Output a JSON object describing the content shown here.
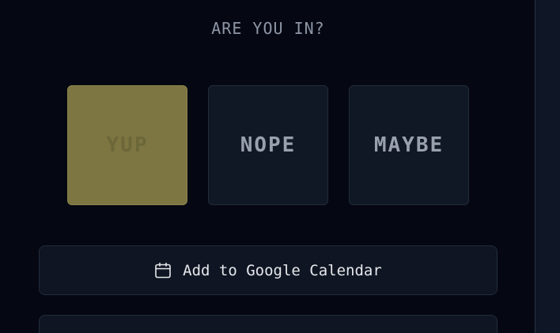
{
  "rsvp": {
    "question": "ARE YOU IN?",
    "options": [
      {
        "label": "YUP",
        "selected": true
      },
      {
        "label": "NOPE",
        "selected": false
      },
      {
        "label": "MAYBE",
        "selected": false
      }
    ]
  },
  "calendar": {
    "label": "Add to Google Calendar",
    "icon": "calendar-icon"
  },
  "colors": {
    "background": "#050812",
    "selected_option": "#7d7643",
    "option_bg": "#111825",
    "text_muted": "#8e96a6"
  }
}
